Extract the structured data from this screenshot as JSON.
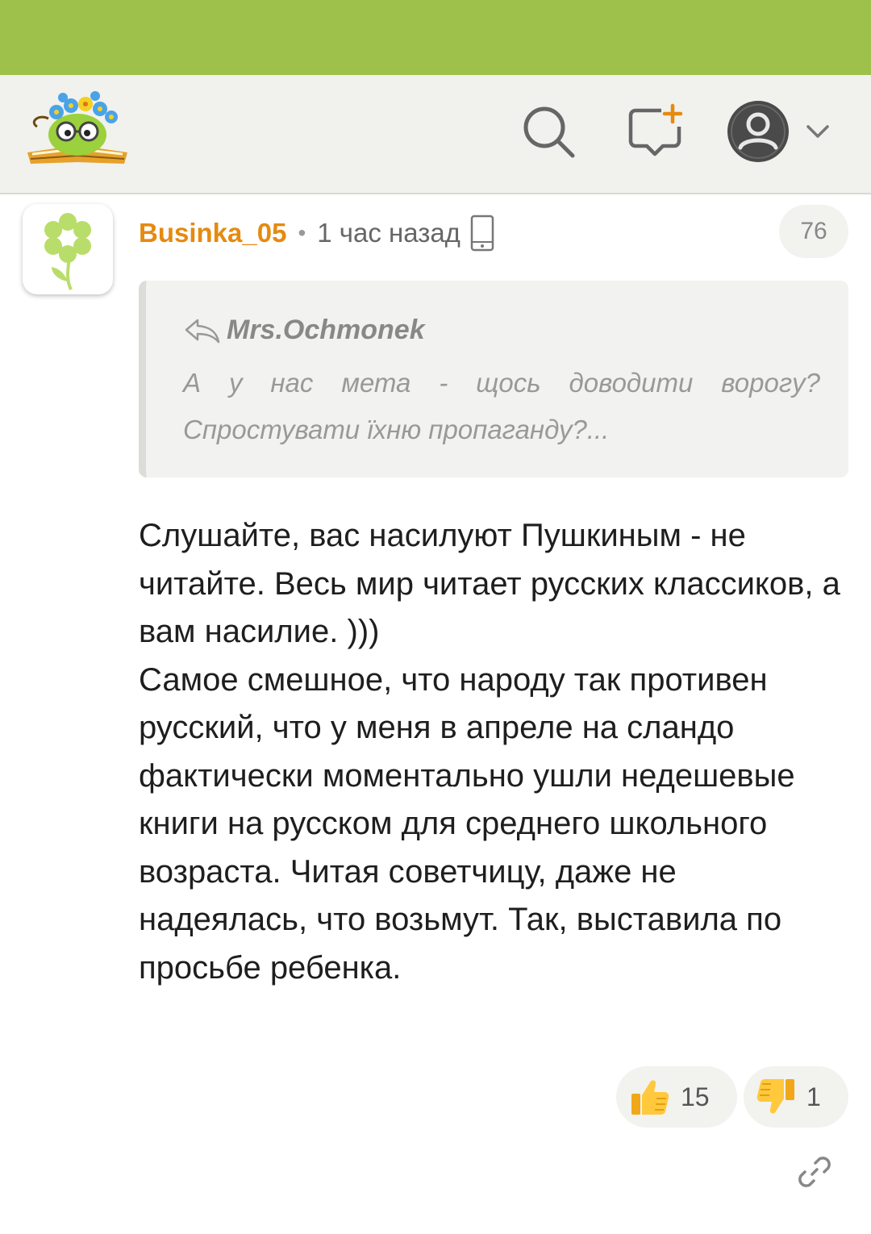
{
  "header": {
    "logo": "book-flower-logo",
    "icons": [
      "search-icon",
      "new-post-icon",
      "user-icon",
      "chevron-down-icon"
    ]
  },
  "comment": {
    "author": "Businka_05",
    "separator": "•",
    "time": "1 час назад",
    "count": "76",
    "quote": {
      "author": "Mrs.Ochmonek",
      "text": "А у нас мета - щось доводити ворогу? Спростувати їхню пропаганду?..."
    },
    "text": "Слушайте, вас насилуют Пушкиным - не читайте. Весь мир читает русских классиков, а вам насилие. )))\nСамое смешное, что народу так противен русский, что у меня в апреле на сландо фактически моментально ушли недешевые книги на русском для среднего школьного возраста. Читая советчицу, даже не надеялась, что возьмут. Так, выставила по просьбе ребенка.",
    "likes": "15",
    "dislikes": "1"
  },
  "colors": {
    "status_bar": "#9dc14a",
    "header_bg": "#f1f1ed",
    "author": "#e58a10"
  }
}
